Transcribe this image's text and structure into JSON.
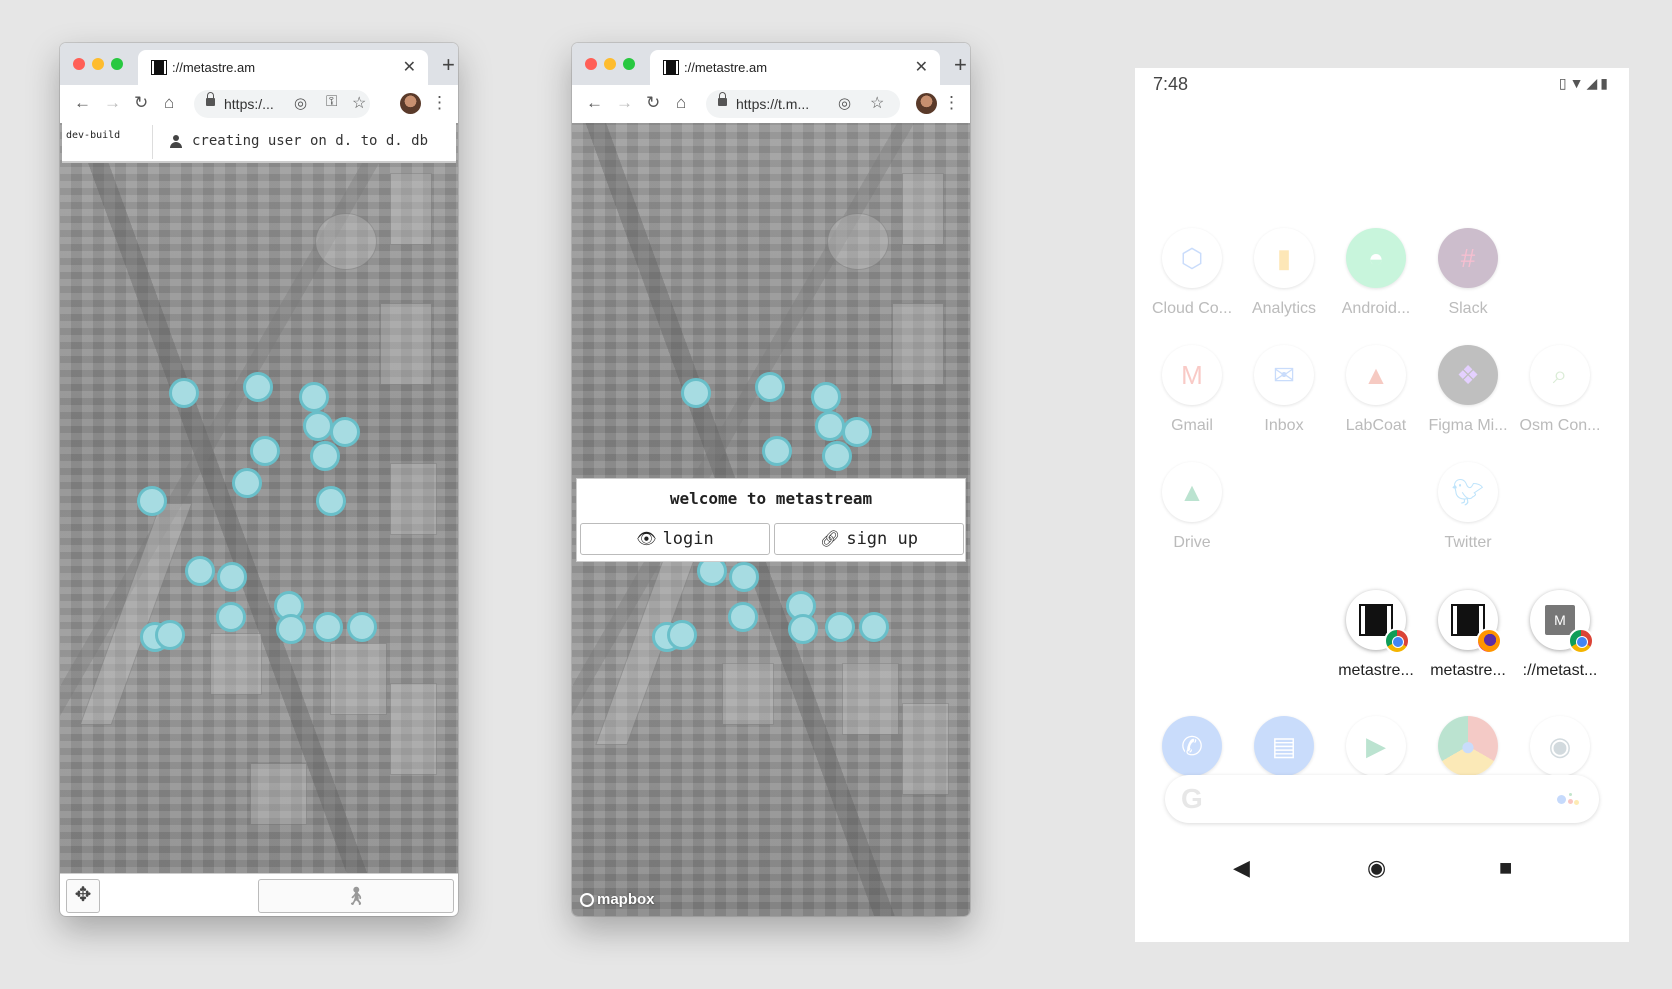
{
  "window1": {
    "tab_title": "://metastre.am",
    "url": "https:/...",
    "dev_label": "dev-build",
    "dev_status": "creating user on d. to d. db"
  },
  "window2": {
    "tab_title": "://metastre.am",
    "url": "https://t.m...",
    "welcome_title": "welcome to metastream",
    "login_label": "login",
    "signup_label": "sign up",
    "map_attribution": "mapbox"
  },
  "phone": {
    "time": "7:48",
    "apps": [
      {
        "label": "Cloud Co...",
        "icon": "cloud-console-icon",
        "color": "#4285f4"
      },
      {
        "label": "Analytics",
        "icon": "analytics-icon",
        "color": "#f9ab00"
      },
      {
        "label": "Android...",
        "icon": "android-icon",
        "color": "#3ddc84"
      },
      {
        "label": "Slack",
        "icon": "slack-icon",
        "color": "#4a154b"
      },
      {
        "label": "Gmail",
        "icon": "gmail-icon",
        "color": "#ea4335"
      },
      {
        "label": "Inbox",
        "icon": "inbox-icon",
        "color": "#4285f4"
      },
      {
        "label": "LabCoat",
        "icon": "labcoat-icon",
        "color": "#e24329"
      },
      {
        "label": "Figma Mi...",
        "icon": "figma-icon",
        "color": "#a259ff"
      },
      {
        "label": "Osm Con...",
        "icon": "osm-icon",
        "color": "#7ebc6f"
      },
      {
        "label": "Drive",
        "icon": "drive-icon",
        "color": "#0f9d58"
      },
      {
        "label": "Twitter",
        "icon": "twitter-icon",
        "color": "#1da1f2"
      },
      {
        "label": "metastre...",
        "icon": "metastream-chrome-icon"
      },
      {
        "label": "metastre...",
        "icon": "metastream-firefox-icon"
      },
      {
        "label": "://metast...",
        "icon": "metastream-m-icon",
        "glyph": "M"
      }
    ],
    "dock": [
      "phone-icon",
      "messages-icon",
      "play-store-icon",
      "chrome-icon",
      "camera-icon"
    ],
    "search_glyph": "G"
  }
}
